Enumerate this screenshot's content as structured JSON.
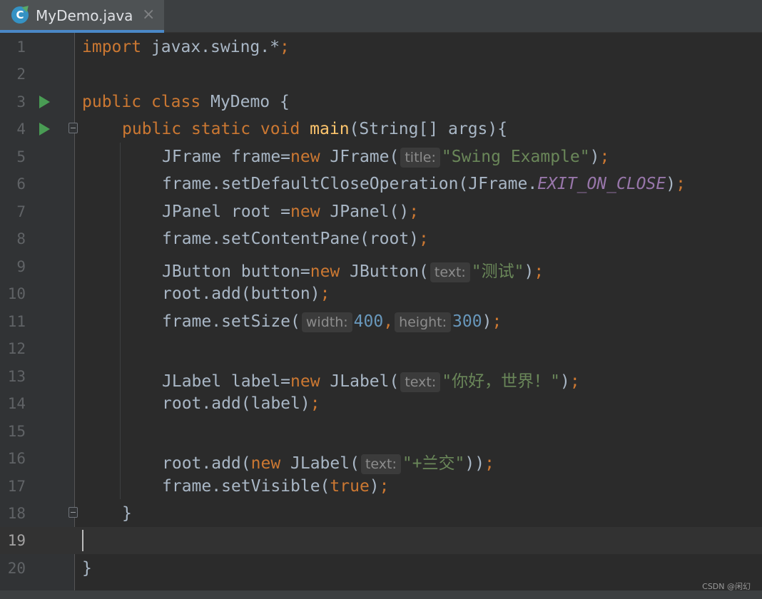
{
  "tab": {
    "filename": "MyDemo.java",
    "icon": "java-class-icon",
    "icon_letter": "C",
    "close_icon": "×"
  },
  "code": {
    "line_numbers": [
      "1",
      "2",
      "3",
      "4",
      "5",
      "6",
      "7",
      "8",
      "9",
      "10",
      "11",
      "12",
      "13",
      "14",
      "15",
      "16",
      "17",
      "18",
      "19",
      "20"
    ],
    "line1": {
      "kw": "import",
      "rest": " javax.swing.*",
      "semi": ";"
    },
    "line3": {
      "kw1": "public",
      "kw2": "class",
      "rest": " MyDemo {"
    },
    "line4": {
      "kw1": "public",
      "kw2": "static",
      "kw3": "void",
      "fn": "main",
      "rest": "(String[] args){"
    },
    "line5": {
      "pre": "JFrame frame=",
      "kw": "new",
      "mid": " JFrame(",
      "hint": "title:",
      "str": "\"Swing Example\"",
      "end": ")",
      "semi": ";"
    },
    "line6": {
      "pre": "frame.setDefaultCloseOperation(JFrame.",
      "const": "EXIT_ON_CLOSE",
      "end": ")",
      "semi": ";"
    },
    "line7": {
      "pre": "JPanel root =",
      "kw": "new",
      "mid": " JPanel()",
      "semi": ";"
    },
    "line8": {
      "pre": "frame.setContentPane(root)",
      "semi": ";"
    },
    "line9": {
      "pre": "JButton button=",
      "kw": "new",
      "mid": " JButton(",
      "hint": "text:",
      "str": "\"测试\"",
      "end": ")",
      "semi": ";"
    },
    "line10": {
      "pre": "root.add(button)",
      "semi": ";"
    },
    "line11": {
      "pre": "frame.setSize(",
      "hint1": "width:",
      "num1": "400",
      "comma": ",",
      "hint2": "height:",
      "num2": "300",
      "end": ")",
      "semi": ";"
    },
    "line13": {
      "pre": "JLabel label=",
      "kw": "new",
      "mid": " JLabel(",
      "hint": "text:",
      "str": "\"你好，世界！\"",
      "end": ")",
      "semi": ";"
    },
    "line14": {
      "pre": "root.add(label)",
      "semi": ";"
    },
    "line16": {
      "pre": "root.add(",
      "kw": "new",
      "mid": " JLabel(",
      "hint": "text:",
      "str": "\"+兰交\"",
      "end": "))",
      "semi": ";"
    },
    "line17": {
      "pre": "frame.setVisible(",
      "kw": "true",
      "end": ")",
      "semi": ";"
    },
    "line18": {
      "text": "}"
    },
    "line20": {
      "text": "}"
    }
  },
  "current_line": "19",
  "watermark": "CSDN @闲幻",
  "colors": {
    "background": "#2b2b2b",
    "keyword": "#cc7832",
    "function": "#ffc66d",
    "string": "#6a8759",
    "number": "#6897bb",
    "constant": "#9876aa",
    "default_text": "#a9b7c6",
    "run_icon": "#499c54"
  }
}
